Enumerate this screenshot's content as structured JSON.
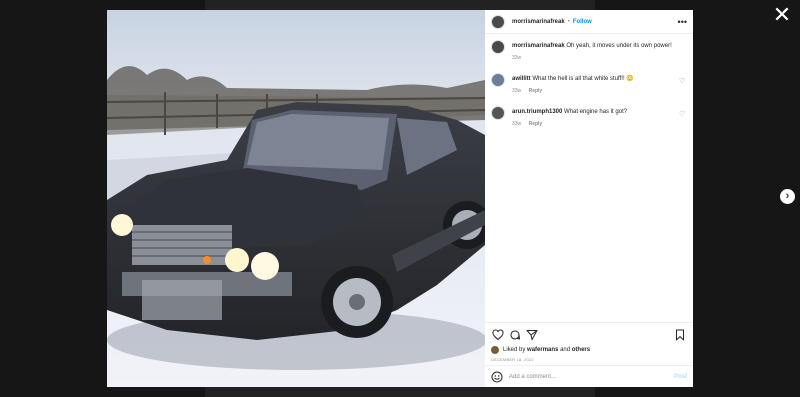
{
  "post": {
    "username": "morrismarinafreak",
    "follow_label": "Follow",
    "separator": "•",
    "more_label": "•••"
  },
  "comments": [
    {
      "username": "morrismarinafreak",
      "text": "Oh yeah, it moves under its own power!",
      "time": "33w",
      "reply": ""
    },
    {
      "username": "awillitt",
      "text": "What the hell is all that white stuff!! 😳",
      "time": "33w",
      "reply": "Reply"
    },
    {
      "username": "arun.triumph1300",
      "text": "What engine has it got?",
      "time": "33w",
      "reply": "Reply"
    }
  ],
  "likes": {
    "prefix": "Liked by",
    "user": "wafermans",
    "connector": "and",
    "others": "others"
  },
  "date": "DECEMBER 18, 2022",
  "add_comment": {
    "placeholder": "Add a comment...",
    "post_label": "Post"
  },
  "icons": {
    "close": "close-icon",
    "next": "chevron-right-icon",
    "like": "heart-icon",
    "comment": "comment-icon",
    "share": "send-icon",
    "save": "bookmark-icon",
    "emoji": "emoji-icon"
  },
  "colors": {
    "accent": "#0095f6",
    "post_disabled": "#b2dffc",
    "muted": "#8e8e8e"
  }
}
